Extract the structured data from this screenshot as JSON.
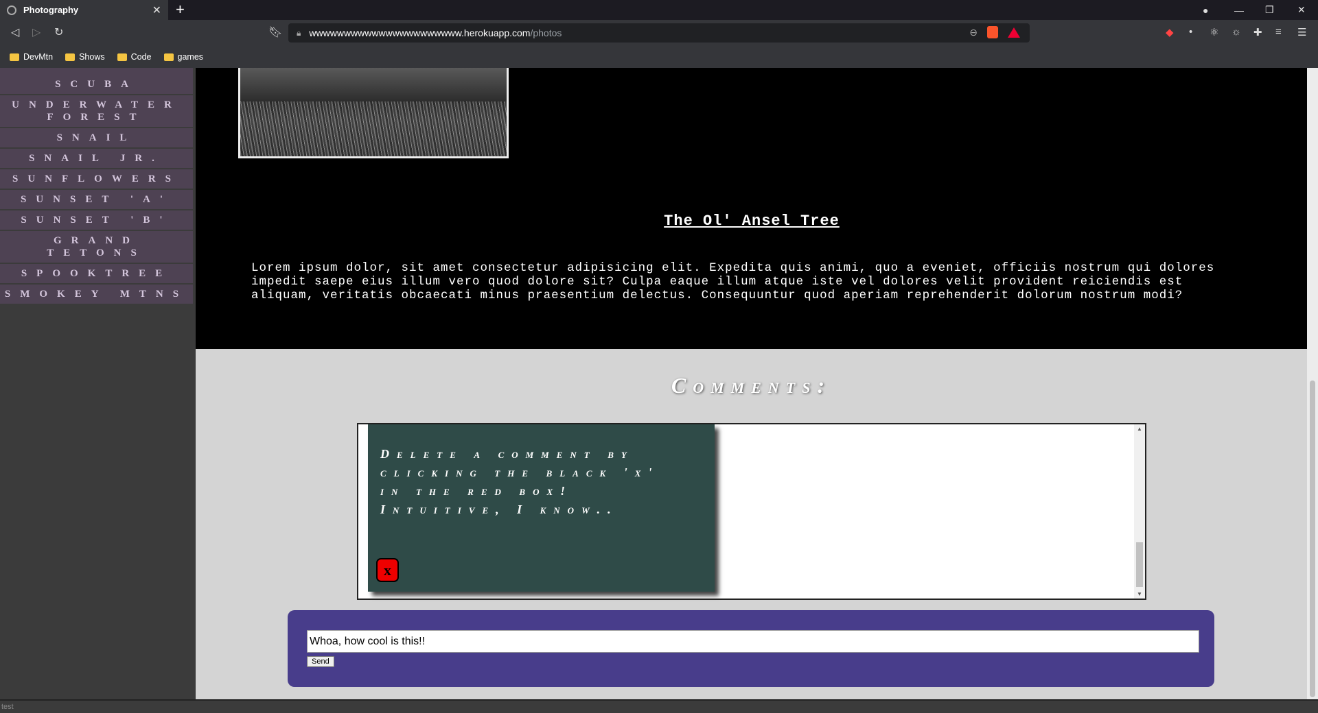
{
  "browser": {
    "tab_title": "Photography",
    "url_host": "wwwwwwwwwwwwwwwwwwwwww.herokuapp.com",
    "url_path": "/photos",
    "bookmarks": [
      "DevMtn",
      "Shows",
      "Code",
      "games"
    ]
  },
  "sidebar": {
    "items": [
      "Scuba",
      "Underwater Forest",
      "Snail",
      "Snail Jr.",
      "Sunflowers",
      "Sunset 'A'",
      "Sunset 'B'",
      "Grand Tetons",
      "Spooktree",
      "Smokey Mtns"
    ]
  },
  "photo": {
    "title": "The Ol' Ansel Tree",
    "description": "Lorem ipsum dolor, sit amet consectetur adipisicing elit. Expedita quis animi, quo a eveniet, officiis nostrum qui dolores impedit saepe eius illum vero quod dolore sit? Culpa eaque illum atque iste vel dolores velit provident reiciendis est aliquam, veritatis obcaecati minus praesentium delectus. Consequuntur quod aperiam reprehenderit dolorum nostrum modi?"
  },
  "comments": {
    "heading": "Comments:",
    "items": [
      {
        "text": "Delete a comment by clicking the black 'x' in the red box! Intuitive, I know..",
        "delete_label": "x"
      }
    ]
  },
  "form": {
    "input_value": "Whoa, how cool is this!!",
    "send_label": "Send"
  },
  "status": {
    "text": "test"
  },
  "colors": {
    "sidebar_item_bg": "#4e4253",
    "comment_card_bg": "#2f4b48",
    "form_bg": "#483d8b",
    "delete_btn": "#ee0000"
  }
}
